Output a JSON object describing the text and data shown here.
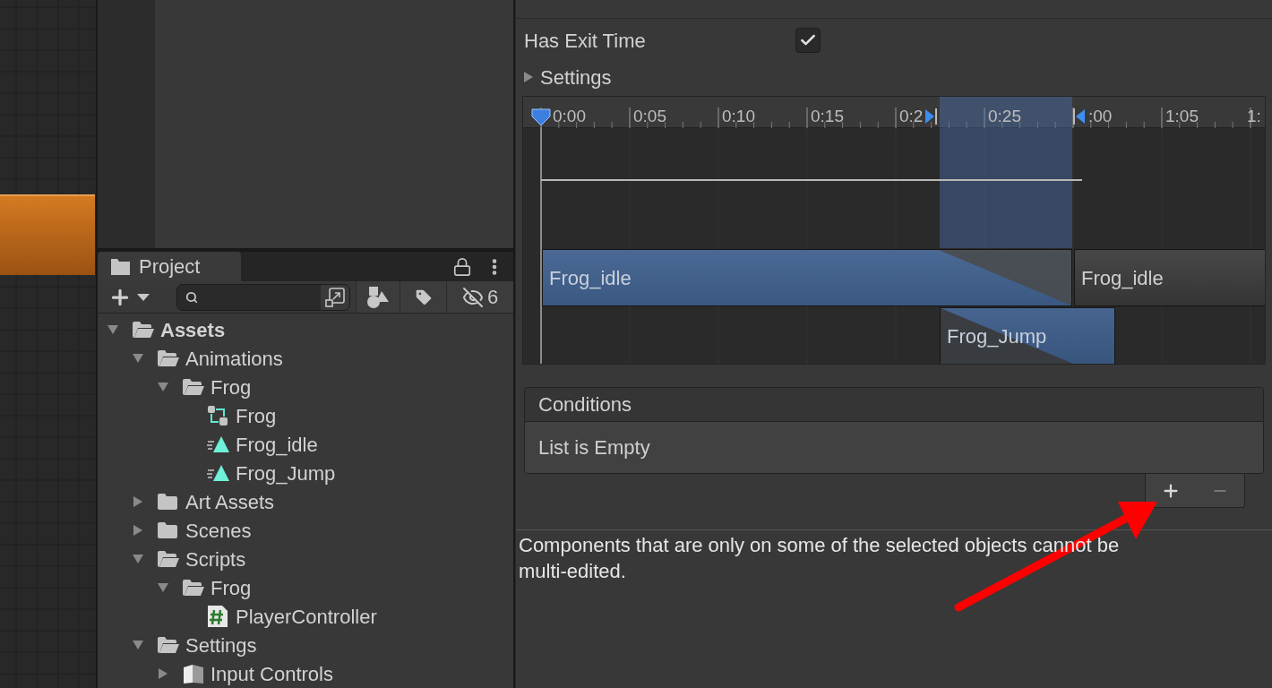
{
  "project": {
    "tab": {
      "label": "Project",
      "selected": true
    },
    "hidden_count": "6",
    "tree": [
      {
        "label": "Assets",
        "kind": "folder",
        "expanded": true,
        "children": [
          {
            "label": "Animations",
            "kind": "folder",
            "expanded": true,
            "children": [
              {
                "label": "Frog",
                "kind": "folder",
                "expanded": true,
                "children": [
                  {
                    "label": "Frog",
                    "kind": "controller"
                  },
                  {
                    "label": "Frog_idle",
                    "kind": "clip"
                  },
                  {
                    "label": "Frog_Jump",
                    "kind": "clip"
                  }
                ]
              }
            ]
          },
          {
            "label": "Art Assets",
            "kind": "folder",
            "expanded": false
          },
          {
            "label": "Scenes",
            "kind": "folder",
            "expanded": false
          },
          {
            "label": "Scripts",
            "kind": "folder",
            "expanded": true,
            "children": [
              {
                "label": "Frog",
                "kind": "folder",
                "expanded": true,
                "children": [
                  {
                    "label": "PlayerController",
                    "kind": "script"
                  }
                ]
              }
            ]
          },
          {
            "label": "Settings",
            "kind": "folder",
            "expanded": true,
            "children": [
              {
                "label": "Input Controls",
                "kind": "asset",
                "expanded": false
              }
            ]
          }
        ]
      }
    ]
  },
  "inspector": {
    "has_exit_time": {
      "label": "Has Exit Time",
      "checked": true
    },
    "settings": {
      "label": "Settings",
      "expanded": false
    },
    "timeline": {
      "ticks": [
        "0:00",
        "0:05",
        "0:10",
        "0:15",
        "0:2",
        "0:25",
        ":00",
        "1:05",
        "1:"
      ],
      "clips": [
        {
          "label": "Frog_idle",
          "kind": "current"
        },
        {
          "label": "Frog_idle",
          "kind": "next"
        },
        {
          "label": "Frog_Jump",
          "kind": "target"
        }
      ]
    },
    "conditions": {
      "title": "Conditions",
      "empty_text": "List is Empty",
      "remove_disabled": true
    },
    "message": "Components that are only on some of the selected objects cannot be multi-edited."
  }
}
